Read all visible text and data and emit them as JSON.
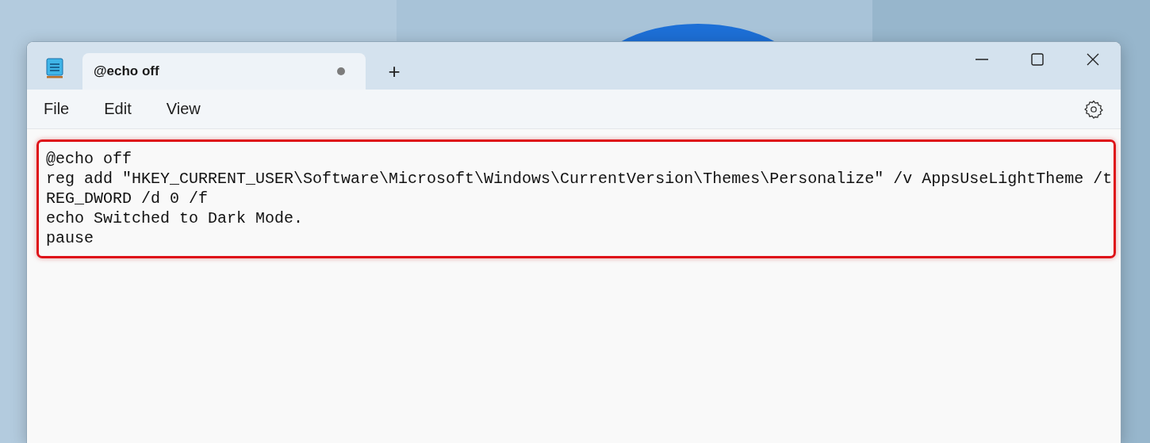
{
  "tabs": [
    {
      "title": "@echo off",
      "unsaved": true,
      "selected": true
    }
  ],
  "new_tab": "+",
  "menu": [
    "File",
    "Edit",
    "View"
  ],
  "editor": {
    "highlighted": true,
    "lines": [
      "@echo off",
      "reg add \"HKEY_CURRENT_USER\\Software\\Microsoft\\Windows\\CurrentVersion\\Themes\\Personalize\" /v AppsUseLightTheme /t",
      "REG_DWORD /d 0 /f",
      "echo Switched to Dark Mode.",
      "pause"
    ]
  }
}
